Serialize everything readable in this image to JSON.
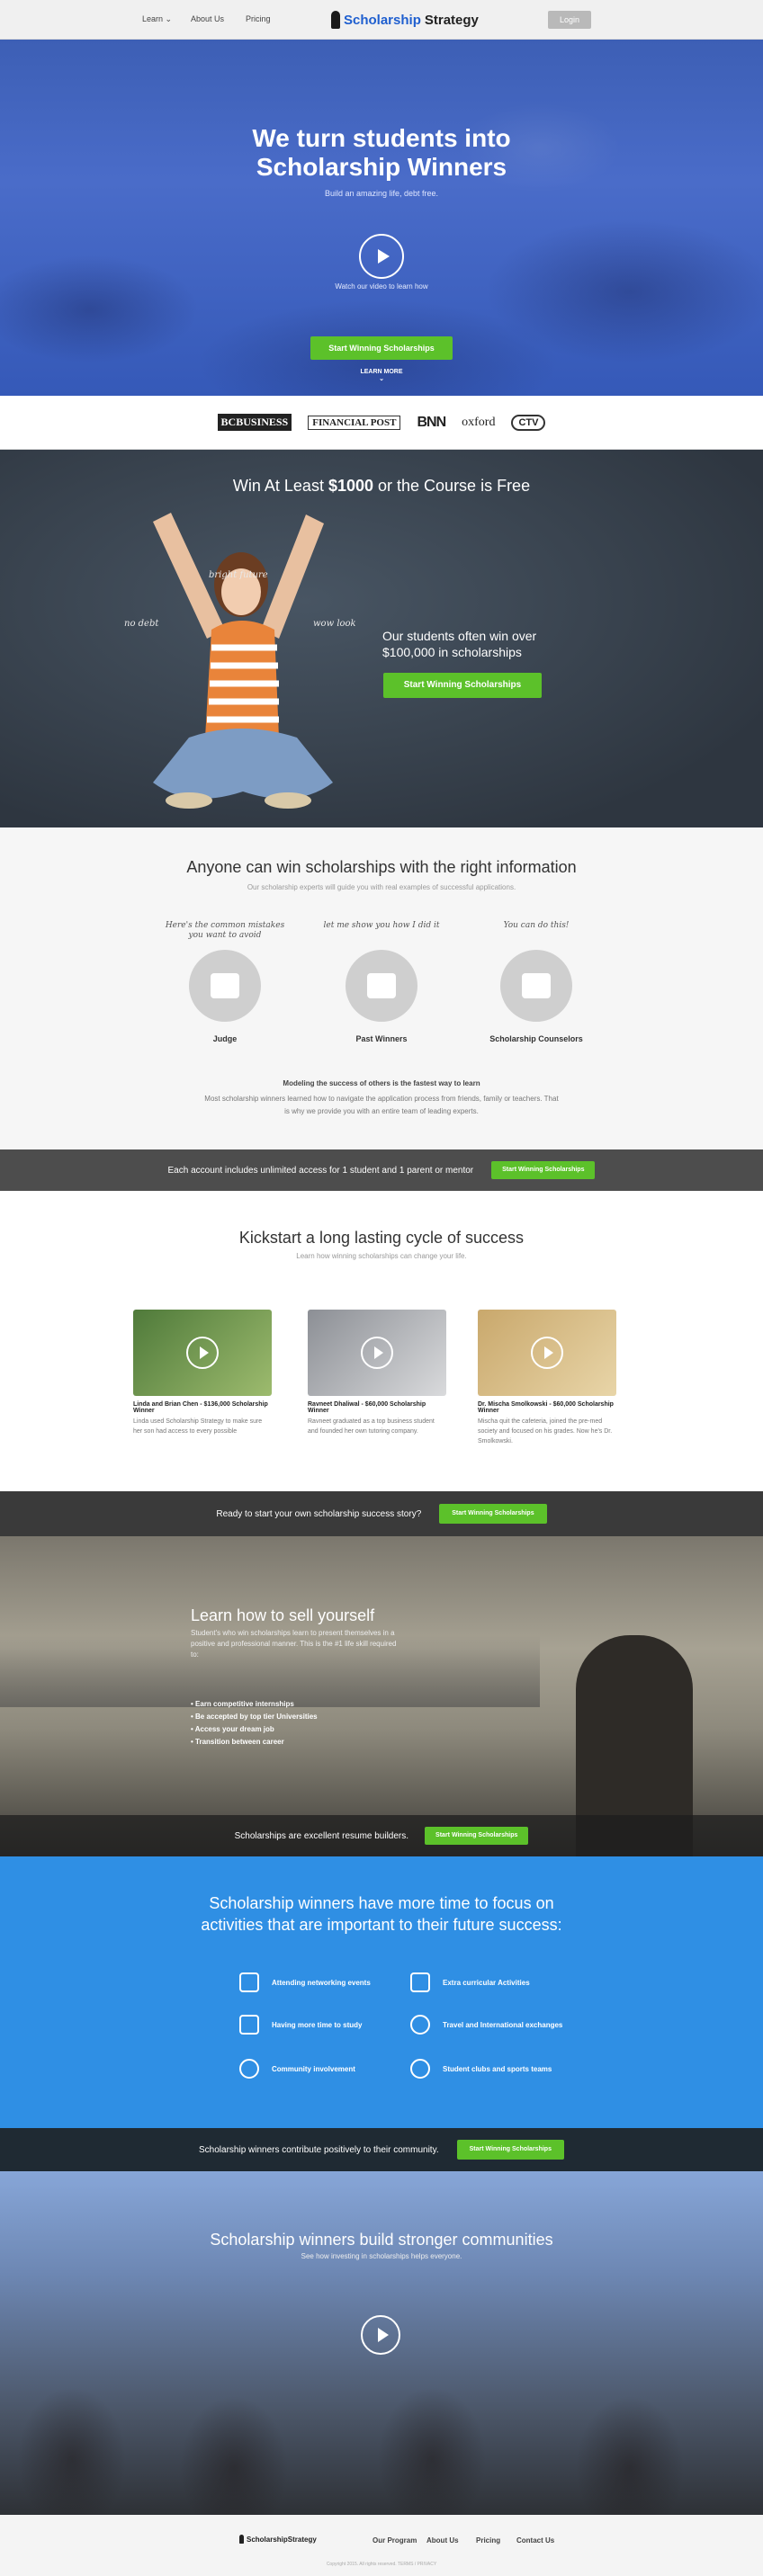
{
  "nav": {
    "learn": "Learn",
    "about": "About Us",
    "pricing": "Pricing",
    "logo_part1": "Scholarship",
    "logo_part2": "Strategy",
    "login": "Login"
  },
  "hero": {
    "title_line1": "We turn students into",
    "title_line2": "Scholarship Winners",
    "subtitle": "Build an amazing life, debt free.",
    "watch": "Watch our video to learn how",
    "cta": "Start Winning Scholarships",
    "learn_more": "LEARN MORE"
  },
  "press": [
    "BCBUSINESS",
    "FINANCIAL POST",
    "BNN",
    "oxford",
    "CTV"
  ],
  "guarantee": {
    "title_pre": "Win At Least ",
    "title_amount": "$1000",
    "title_post": " or the Course is Free",
    "note1": "bright future",
    "note2": "no debt",
    "note3": "wow look",
    "text_line1": "Our students often win over",
    "text_line2": "$100,000 in scholarships",
    "cta": "Start Winning Scholarships"
  },
  "info": {
    "title": "Anyone can win scholarships with the right information",
    "subtitle": "Our scholarship experts will guide you with real examples of successful applications.",
    "columns": [
      {
        "hand": "Here's the common mistakes you want to avoid",
        "caption": "Judge"
      },
      {
        "hand": "let me show you how I did it",
        "caption": "Past Winners"
      },
      {
        "hand": "You can do this!",
        "caption": "Scholarship Counselors"
      }
    ],
    "bold": "Modeling the success of others is the fastest way to learn",
    "para": "Most scholarship winners learned how to navigate the application process from friends, family or teachers. That is why we provide you with an entire team of leading experts."
  },
  "access_bar": {
    "text": "Each account includes unlimited access for 1 student and 1 parent or mentor",
    "cta": "Start Winning Scholarships"
  },
  "stories": {
    "title": "Kickstart a long lasting cycle of success",
    "subtitle": "Learn how winning scholarships can change your life.",
    "items": [
      {
        "name": "Linda and Brian Chen - $136,000 Scholarship Winner",
        "text": "Linda used Scholarship Strategy to make sure her son had access to every possible"
      },
      {
        "name": "Ravneet Dhaliwal - $60,000 Scholarship Winner",
        "text": "Ravneet graduated as a top business student and founded her own tutoring company."
      },
      {
        "name": "Dr. Mischa Smolkowski - $60,000 Scholarship Winner",
        "text": "Mischa quit the cafeteria, joined the pre-med society and focused on his grades. Now he's Dr. Smolkowski."
      }
    ]
  },
  "ready_bar": {
    "text": "Ready to start your own scholarship success story?",
    "cta": "Start Winning Scholarships"
  },
  "sell": {
    "title": "Learn how to sell yourself",
    "para": "Student's who win scholarships learn to present themselves in a positive and professional manner. This is the #1 life skill required to:",
    "bullets": [
      "Earn competitive internships",
      "Be accepted by top tier Universities",
      "Access your dream job",
      "Transition between career"
    ],
    "bar_text": "Scholarships are excellent resume builders.",
    "bar_cta": "Start Winning  Scholarships"
  },
  "benefits": {
    "title_line1": "Scholarship winners have more time to focus on",
    "title_line2": "activities that are important to their future success:",
    "items": [
      {
        "icon": "briefcase-icon",
        "label": "Attending networking events"
      },
      {
        "icon": "camera-icon",
        "label": "Extra curricular Activities"
      },
      {
        "icon": "phone-icon",
        "label": "Having more time to study"
      },
      {
        "icon": "airplane-icon",
        "label": "Travel and International exchanges"
      },
      {
        "icon": "globe-icon",
        "label": "Community involvement"
      },
      {
        "icon": "heart-icon",
        "label": "Student clubs and sports teams"
      }
    ]
  },
  "contribute_bar": {
    "text": "Scholarship winners contribute positively to their community.",
    "cta": "Start Winning  Scholarships"
  },
  "communities": {
    "title": "Scholarship winners build stronger communities",
    "subtitle": "See how investing in scholarships helps everyone."
  },
  "footer": {
    "logo": "ScholarshipStrategy",
    "links": [
      "Our Program",
      "About Us",
      "Pricing",
      "Contact Us"
    ],
    "copyright": "Copyright 2015. All rights reserved.    TERMS / PRIVACY"
  }
}
